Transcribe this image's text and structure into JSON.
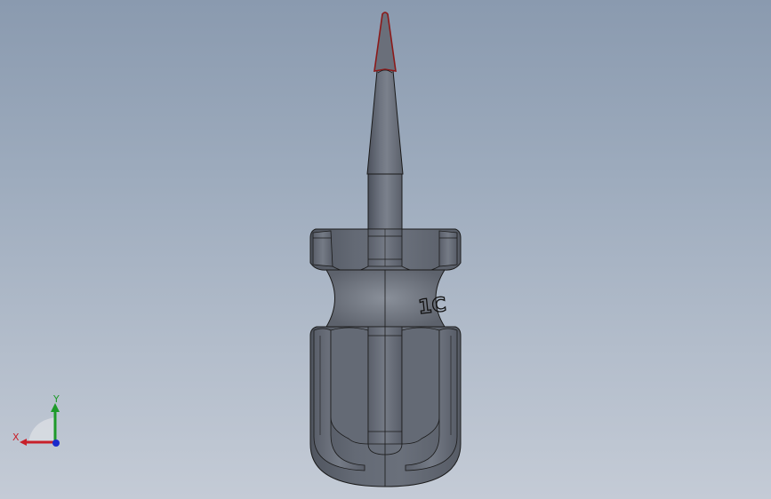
{
  "viewport": {
    "background_top": "#8a9aaf",
    "background_bottom": "#c4cbd6"
  },
  "model": {
    "name_icon": "screwdriver-3d-model",
    "handle_engraving": "1C",
    "body_color": "#5f6470",
    "edge_color": "#1a1a1a",
    "tip_edge_color": "#8b1a1a"
  },
  "triad": {
    "x_label": "X",
    "y_label": "Y",
    "x_color": "#c8202a",
    "y_color": "#1e9a2a",
    "z_color": "#1a2acc"
  }
}
